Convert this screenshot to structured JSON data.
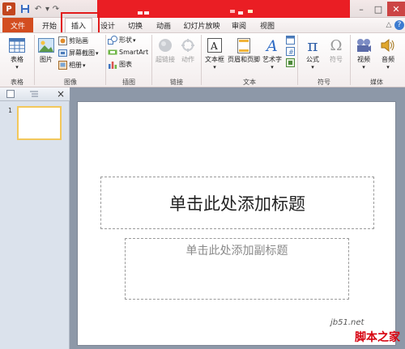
{
  "titlebar": {
    "app_icon": "P",
    "quick_access": [
      "save-icon",
      "undo-icon",
      "redo-icon"
    ],
    "window_controls": [
      "–",
      "□",
      "✕"
    ]
  },
  "tabs": [
    {
      "label": "文件"
    },
    {
      "label": "开始"
    },
    {
      "label": "插入",
      "active": true
    },
    {
      "label": "设计"
    },
    {
      "label": "切换"
    },
    {
      "label": "动画"
    },
    {
      "label": "幻灯片放映"
    },
    {
      "label": "审阅"
    },
    {
      "label": "视图"
    }
  ],
  "ribbon": {
    "groups": {
      "table": "表格",
      "image": "图像",
      "illustrations": "插图",
      "links": "链接",
      "text": "文本",
      "symbols": "符号",
      "media": "媒体"
    },
    "buttons": {
      "table": "表格",
      "picture": "图片",
      "clipart": "剪贴画",
      "screenshot": "屏幕截图",
      "album": "相册",
      "shapes": "形状",
      "smartart": "SmartArt",
      "chart": "图表",
      "hyperlink": "超链接",
      "action": "动作",
      "textbox": "文本框",
      "header_footer": "页眉和页脚",
      "wordart": "艺术字",
      "equation": "公式",
      "symbol": "符号",
      "video": "视频",
      "audio": "音频"
    }
  },
  "slides_panel": {
    "thumb_number": "1"
  },
  "slide": {
    "title_placeholder": "单击此处添加标题",
    "subtitle_placeholder": "单击此处添加副标题"
  },
  "watermark": {
    "url": "jb51.net",
    "name": "脚本之家"
  },
  "colors": {
    "file_tab": "#d34d20",
    "title_bar_red": "#ea1e24",
    "highlight": "#e21b1b",
    "workspace": "#8d98a8"
  }
}
